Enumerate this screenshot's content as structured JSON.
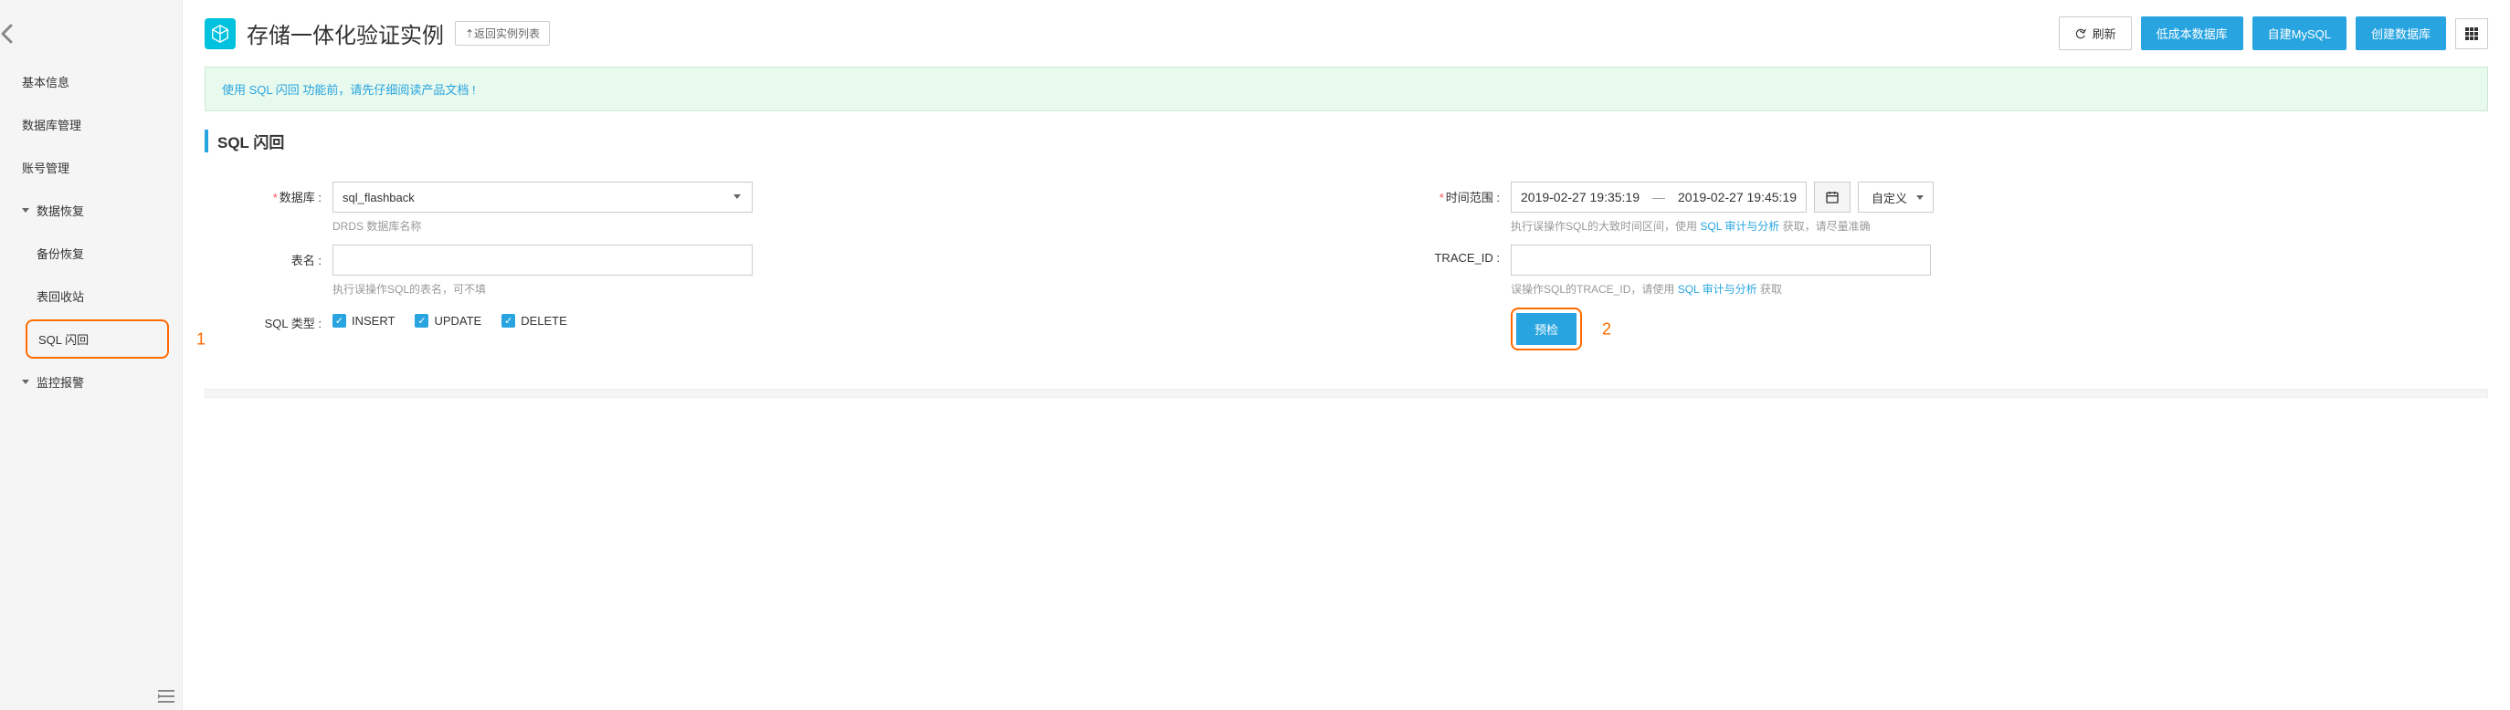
{
  "sidebar": {
    "items": {
      "basic": "基本信息",
      "dbManage": "数据库管理",
      "account": "账号管理",
      "dataRestore": "数据恢复",
      "backupRestore": "备份恢复",
      "tableRecycle": "表回收站",
      "sqlFlashback": "SQL 闪回",
      "monitorAlarm": "监控报警"
    },
    "highlightNum": "1"
  },
  "header": {
    "title": "存储一体化验证实例",
    "backLink": "⇡返回实例列表",
    "refresh": "刷新",
    "lowCostDb": "低成本数据库",
    "selfMysql": "自建MySQL",
    "createDb": "创建数据库"
  },
  "notice": "使用 SQL 闪回 功能前，请先仔细阅读产品文档 !",
  "section": {
    "title": "SQL 闪回"
  },
  "form": {
    "dbLabel": "数据库 :",
    "dbValue": "sql_flashback",
    "dbHelp": "DRDS 数据库名称",
    "tableLabel": "表名 :",
    "tableHelp": "执行误操作SQL的表名，可不填",
    "sqlTypeLabel": "SQL 类型 :",
    "sqlTypes": {
      "insert": "INSERT",
      "update": "UPDATE",
      "delete": "DELETE"
    },
    "timeLabel": "时间范围 :",
    "timeStart": "2019-02-27 19:35:19",
    "timeEnd": "2019-02-27 19:45:19",
    "timePreset": "自定义",
    "timeHelpPre": "执行误操作SQL的大致时间区间，使用 ",
    "timeHelpLink": "SQL 审计与分析",
    "timeHelpPost": " 获取，请尽量准确",
    "traceLabel": "TRACE_ID :",
    "traceHelpPre": "误操作SQL的TRACE_ID，请使用 ",
    "traceHelpLink": "SQL 审计与分析",
    "traceHelpPost": " 获取",
    "precheck": "预检",
    "precheckNum": "2"
  }
}
